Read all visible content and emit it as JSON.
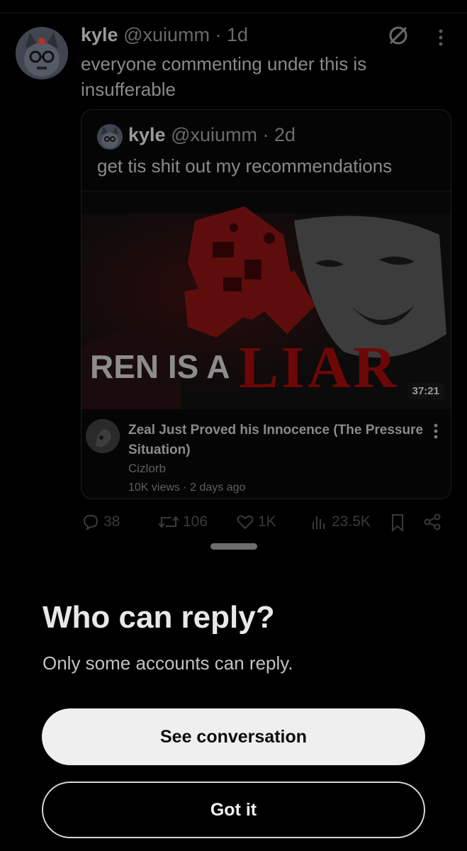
{
  "tweet": {
    "author_name": "kyle",
    "handle": "@xuiumm",
    "time": "1d",
    "text": "everyone commenting under this is insufferable"
  },
  "quote": {
    "author_name": "kyle",
    "handle": "@xuiumm",
    "time": "2d",
    "text": "get tis shit out my recommendations",
    "video": {
      "thumbnail_text_left": "REN IS A",
      "thumbnail_text_right": "LIAR",
      "duration": "37:21",
      "title": "Zeal Just Proved his Innocence (The Pressure Situation)",
      "channel": "Cizlorb",
      "meta": "10K views · 2 days ago"
    }
  },
  "actions": {
    "replies": "38",
    "reposts": "106",
    "likes": "1K",
    "views": "23.5K"
  },
  "sheet": {
    "title": "Who can reply?",
    "subtitle": "Only some accounts can reply.",
    "primary_button": "See conversation",
    "secondary_button": "Got it"
  }
}
